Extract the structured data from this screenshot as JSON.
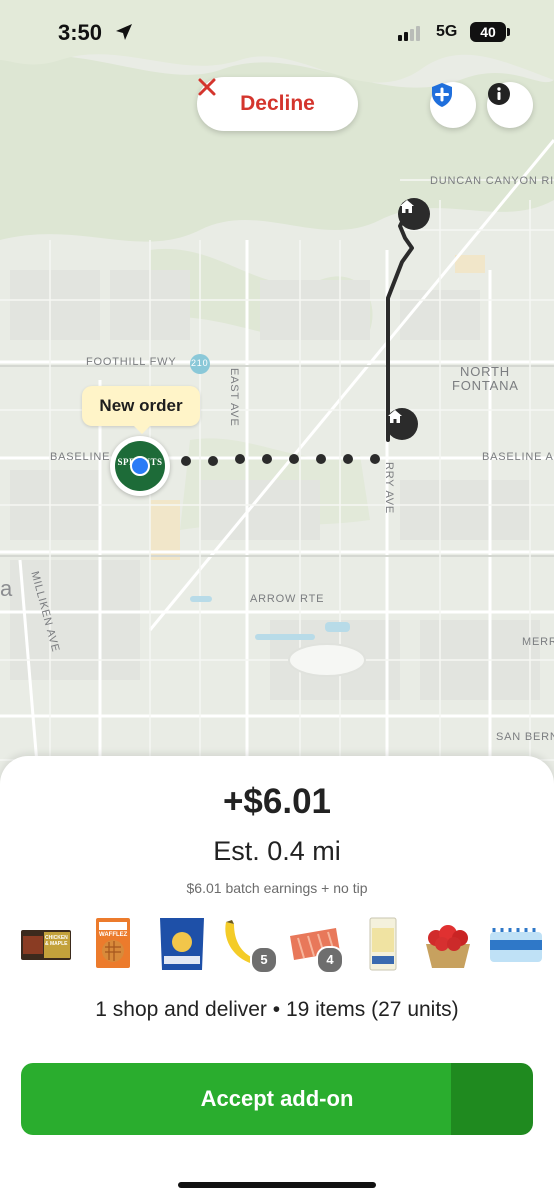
{
  "status_bar": {
    "time": "3:50",
    "network": "5G",
    "battery": "40"
  },
  "map": {
    "decline_label": "Decline",
    "tooltip": "New order",
    "labels": {
      "duncan": "DUNCAN CANYON RI",
      "foothill": "FOOTHILL FWY",
      "route_shield": "210",
      "east_ave": "EAST AVE",
      "north_fontana_1": "NORTH",
      "north_fontana_2": "FONTANA",
      "baseline_left": "BASELINE",
      "baseline_right": "BASELINE A",
      "cherry_ave": "RRY AVE",
      "arrow_rte": "ARROW RTE",
      "milliken": "MILLIKEN AVE",
      "merr": "MERR",
      "san_bern": "SAN BERN",
      "edge_letter": "a"
    },
    "store_logo_text": "SPROUTS",
    "icons": [
      "shield-plus-icon",
      "info-icon",
      "close-x-icon",
      "home-icon",
      "location-arrow-icon"
    ],
    "colors": {
      "route": "#2b2b2b",
      "decline": "#d4352d",
      "store": "#1d6b38",
      "position_dot": "#2b7cf6"
    }
  },
  "sheet": {
    "earnings": "+$6.01",
    "distance": "Est. 0.4 mi",
    "batch_info": "$6.01 batch earnings + no tip",
    "items": [
      {
        "name": "chicken-maple-sausage",
        "icon": "sausage-package-icon",
        "text": "CHICKEN & MAPLE"
      },
      {
        "name": "waffles",
        "icon": "waffle-box-icon",
        "text": "WAFFLEZ"
      },
      {
        "name": "snack-bag",
        "icon": "snack-bag-icon"
      },
      {
        "name": "bananas",
        "icon": "banana-icon",
        "badge": "5"
      },
      {
        "name": "salmon",
        "icon": "salmon-icon",
        "badge": "4"
      },
      {
        "name": "cheese-pack",
        "icon": "cheese-pack-icon"
      },
      {
        "name": "strawberries",
        "icon": "strawberry-basket-icon"
      },
      {
        "name": "water-case",
        "icon": "water-bottles-icon"
      }
    ],
    "summary": "1 shop and deliver • 19 items (27 units)",
    "accept_label": "Accept add-on",
    "accept_colors": {
      "main": "#2aad2e",
      "side": "#1f8a1f"
    }
  }
}
